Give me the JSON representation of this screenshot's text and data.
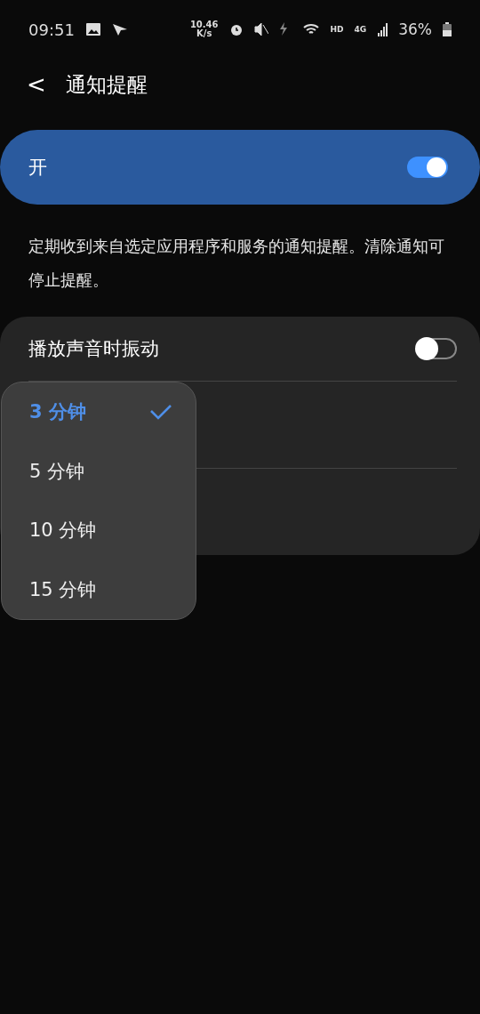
{
  "status_bar": {
    "time": "09:51",
    "speed_value": "10.46",
    "speed_unit": "K/s",
    "hd": "HD",
    "network": "4G",
    "battery": "36%"
  },
  "header": {
    "back": "<",
    "title": "通知提醒"
  },
  "master_switch": {
    "label": "开",
    "on": true
  },
  "description": "定期收到来自选定应用程序和服务的通知提醒。清除通知可停止提醒。",
  "settings": [
    {
      "label": "播放声音时振动",
      "on": false
    }
  ],
  "dropdown": {
    "options": [
      {
        "label": "3 分钟",
        "selected": true
      },
      {
        "label": "5 分钟",
        "selected": false
      },
      {
        "label": "10 分钟",
        "selected": false
      },
      {
        "label": "15 分钟",
        "selected": false
      }
    ]
  }
}
